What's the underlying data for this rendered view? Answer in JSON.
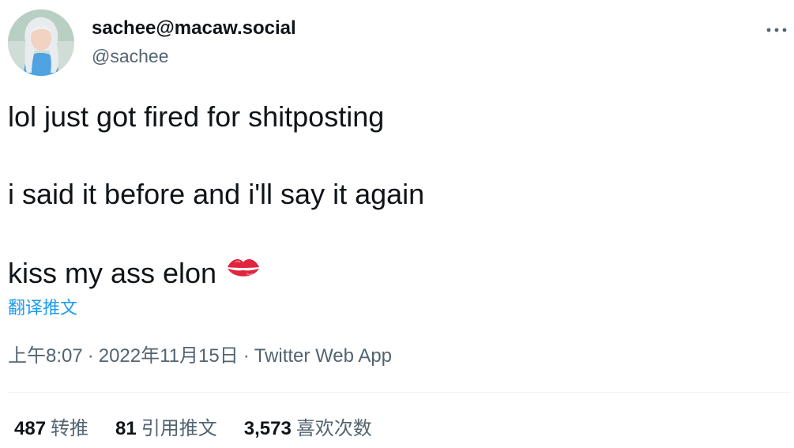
{
  "user": {
    "display_name": "sachee@macaw.social",
    "handle": "@sachee"
  },
  "tweet": {
    "lines": [
      "lol just got fired for shitposting",
      "i said it before and i'll say it again",
      "kiss my ass elon"
    ],
    "emoji": "kiss-mark-emoji",
    "translate_label": "翻译推文"
  },
  "meta": {
    "time": "上午8:07",
    "separator": "·",
    "date": "2022年11月15日",
    "app": "Twitter Web App"
  },
  "stats": {
    "retweets": {
      "count": "487",
      "label": "转推"
    },
    "quotes": {
      "count": "81",
      "label": "引用推文"
    },
    "likes": {
      "count": "3,573",
      "label": "喜欢次数"
    }
  },
  "colors": {
    "text": "#0f1419",
    "secondary": "#536471",
    "accent": "#1d9bf0",
    "divider": "#eff3f4",
    "emoji_red": "#e0253f"
  },
  "icons": {
    "more": "more-horizontal-icon"
  }
}
